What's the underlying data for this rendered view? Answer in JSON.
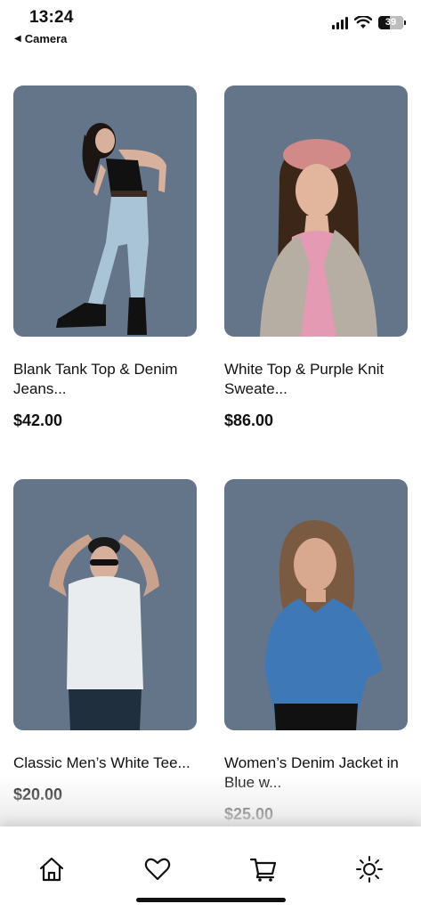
{
  "status_bar": {
    "time": "13:24",
    "back_label": "Camera",
    "battery": "39"
  },
  "products": [
    {
      "title": "Blank Tank Top & Denim Jeans...",
      "price": "$42.00"
    },
    {
      "title": "White Top & Purple Knit Sweate...",
      "price": "$86.00"
    },
    {
      "title": "Classic Men’s White Tee...",
      "price": "$20.00"
    },
    {
      "title": "Women’s Denim Jacket in Blue w...",
      "price": "$25.00"
    }
  ],
  "tab_bar": {
    "items": [
      {
        "icon": "home-icon"
      },
      {
        "icon": "heart-icon"
      },
      {
        "icon": "cart-icon"
      },
      {
        "icon": "sun-icon"
      }
    ]
  },
  "colors": {
    "card_background": "#647489",
    "text": "#111111"
  }
}
